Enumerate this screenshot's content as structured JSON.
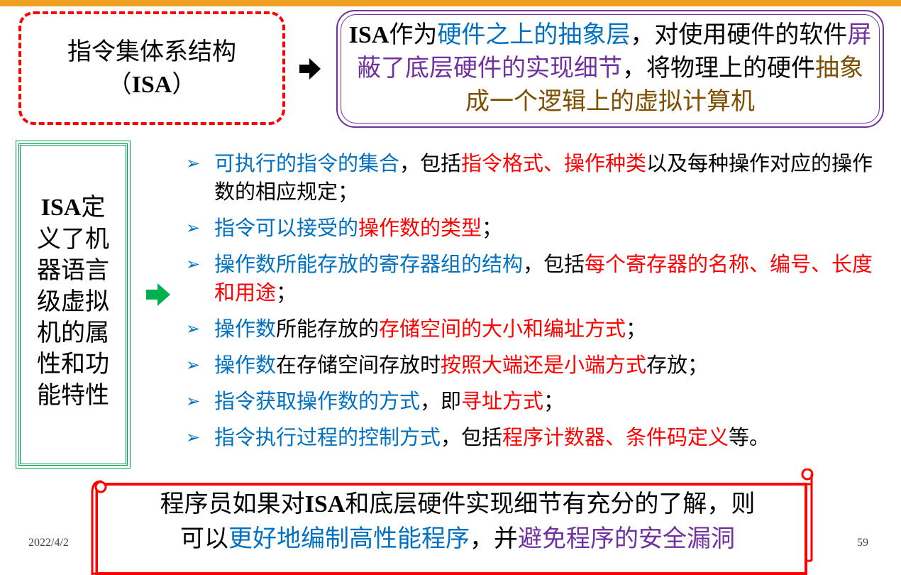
{
  "isa_box": {
    "line1": "指令集体系结构",
    "line2_open": "（",
    "line2_en": "ISA",
    "line2_close": "）"
  },
  "desc": {
    "p1": "ISA",
    "p2": "作为",
    "p3": "硬件之上的抽象层",
    "p4": "，对使用硬件的软件",
    "p5": "屏蔽了底层硬件的实现细节",
    "p6": "，将物理上的硬件",
    "p7": "抽象成一个逻辑上的虚拟计算机"
  },
  "side": {
    "en": "ISA",
    "rest1": "定",
    "lines": [
      "义了机",
      "器语言",
      "级虚拟",
      "机的属",
      "性和功",
      "能特性"
    ]
  },
  "bullet_marker": "➢",
  "bullets": [
    {
      "a": "可执行的指令的集合",
      "b": "，包括",
      "c": "指令格式、操作种类",
      "d": "以及每种操作对应的操作数的相应规定；"
    },
    {
      "a": "指令可以接受的",
      "b": "",
      "c": "操作数的类型",
      "d": "；"
    },
    {
      "a": "操作数所能存放的寄存器组的结构",
      "b": "，包括",
      "c": "每个寄存器的名称、编号、长度和用途",
      "d": "；"
    },
    {
      "a": "操作数",
      "b": "所能存放的",
      "c": "存储空间的大小和编址方式",
      "d": "；"
    },
    {
      "a": "操作数",
      "b": "在存储空间存放时",
      "c": "按照大端还是小端方式",
      "d": "存放；"
    },
    {
      "a": "指令获取操作数的方式",
      "b": "，即",
      "c": "寻址方式",
      "d": "；"
    },
    {
      "a": "指令执行过程的控制方式",
      "b": "，包括",
      "c": "程序计数器、条件码定义",
      "d": "等。"
    }
  ],
  "scroll": {
    "l1a": "程序员如果对",
    "l1b": "ISA",
    "l1c": "和底层硬件实现细节有充分的了解，则",
    "l2a": "可以",
    "l2b": "更好地编制高性能程序",
    "l2c": "，并",
    "l2d": "避免程序的安全漏洞"
  },
  "footer": {
    "date": "2022/4/2",
    "page": "59"
  },
  "colors": {
    "blue": "#0070c0",
    "red": "#ff0000",
    "purple": "#7030a0",
    "brown": "#7f4f00",
    "green": "#00a050",
    "orange": "#f0a020"
  }
}
